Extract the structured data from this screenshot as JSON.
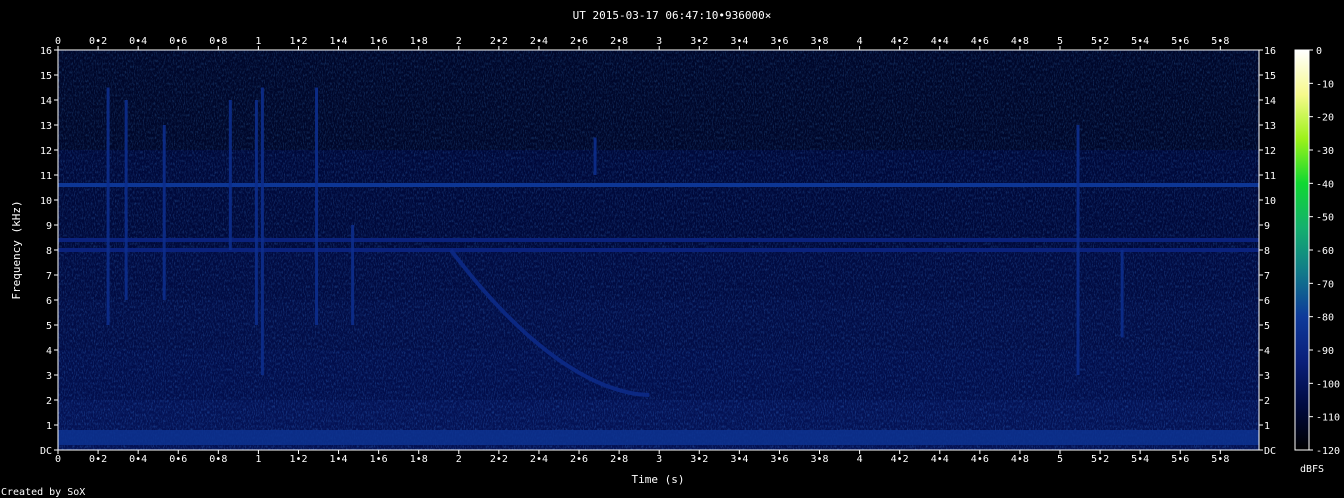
{
  "chart_data": {
    "type": "heatmap",
    "title": "UT 2015-03-17 06:47:10•936000×",
    "xlabel": "Time (s)",
    "ylabel": "Frequency (kHz)",
    "xlim": [
      0,
      6.0
    ],
    "ylim": [
      0,
      16
    ],
    "x_ticks": [
      "0",
      "0•2",
      "0•4",
      "0•6",
      "0•8",
      "1",
      "1•2",
      "1•4",
      "1•6",
      "1•8",
      "2",
      "2•2",
      "2•4",
      "2•6",
      "2•8",
      "3",
      "3•2",
      "3•4",
      "3•6",
      "3•8",
      "4",
      "4•2",
      "4•4",
      "4•6",
      "4•8",
      "5",
      "5•2",
      "5•4",
      "5•6",
      "5•8"
    ],
    "y_ticks": [
      "DC",
      "1",
      "2",
      "3",
      "4",
      "5",
      "6",
      "7",
      "8",
      "9",
      "10",
      "11",
      "12",
      "13",
      "14",
      "15",
      "16"
    ],
    "colorbar": {
      "label": "dBFS",
      "ticks": [
        "0",
        "-10",
        "-20",
        "-30",
        "-40",
        "-50",
        "-60",
        "-70",
        "-80",
        "-90",
        "-100",
        "-110",
        "-120"
      ],
      "range": [
        -120,
        0
      ],
      "colors": [
        "#000000",
        "#000a40",
        "#0a1f7a",
        "#0e3a9a",
        "#117a8a",
        "#14b06e",
        "#10d832",
        "#9cf21a",
        "#f6fa8c",
        "#ffffff"
      ]
    },
    "features": {
      "background_dbfs": -108,
      "noise_floor_low_khz": [
        0.2,
        0.8
      ],
      "tones": [
        {
          "freq_khz": 10.6,
          "level_dbfs": -82
        },
        {
          "freq_khz": 8.4,
          "level_dbfs": -92
        },
        {
          "freq_khz": 8.0,
          "level_dbfs": -92
        }
      ],
      "impulses": [
        {
          "t": 0.25,
          "f_min": 5.0,
          "f_max": 14.5
        },
        {
          "t": 0.34,
          "f_min": 6.0,
          "f_max": 14.0
        },
        {
          "t": 0.53,
          "f_min": 6.0,
          "f_max": 13.0
        },
        {
          "t": 0.86,
          "f_min": 8.0,
          "f_max": 14.0
        },
        {
          "t": 0.99,
          "f_min": 5.0,
          "f_max": 14.0
        },
        {
          "t": 1.02,
          "f_min": 3.0,
          "f_max": 14.5
        },
        {
          "t": 1.29,
          "f_min": 5.0,
          "f_max": 14.5
        },
        {
          "t": 1.47,
          "f_min": 5.0,
          "f_max": 9.0
        },
        {
          "t": 2.68,
          "f_min": 11.0,
          "f_max": 12.5
        },
        {
          "t": 5.09,
          "f_min": 3.0,
          "f_max": 13.0
        },
        {
          "t": 5.31,
          "f_min": 4.5,
          "f_max": 8.0
        }
      ],
      "whistler": {
        "t_start": 1.96,
        "t_end": 2.95,
        "f_start": 8.0,
        "f_end": 2.2
      }
    }
  },
  "footer": {
    "credit": "Created by SoX"
  }
}
